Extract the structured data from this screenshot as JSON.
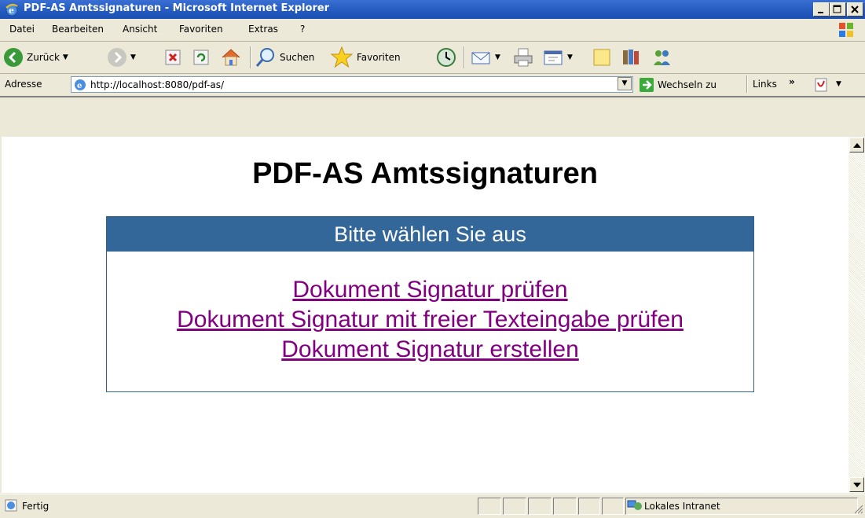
{
  "window": {
    "title": "PDF-AS Amtssignaturen - Microsoft Internet Explorer",
    "icon": "ie-icon"
  },
  "menu": {
    "items": [
      "Datei",
      "Bearbeiten",
      "Ansicht",
      "Favoriten",
      "Extras",
      "?"
    ]
  },
  "toolbar": {
    "back_label": "Zurück",
    "search_label": "Suchen",
    "favorites_label": "Favoriten"
  },
  "address": {
    "label": "Adresse",
    "url": "http://localhost:8080/pdf-as/",
    "go_label": "Wechseln zu",
    "links_label": "Links"
  },
  "page": {
    "title": "PDF-AS Amtssignaturen",
    "panel_header": "Bitte wählen Sie aus",
    "links": [
      "Dokument Signatur prüfen",
      "Dokument Signatur mit freier Texteingabe prüfen",
      "Dokument Signatur erstellen"
    ]
  },
  "status": {
    "text": "Fertig",
    "zone": "Lokales Intranet"
  },
  "colors": {
    "titlebar": "#2a5fc4",
    "panel_header": "#336699",
    "link_visited": "#800080"
  }
}
